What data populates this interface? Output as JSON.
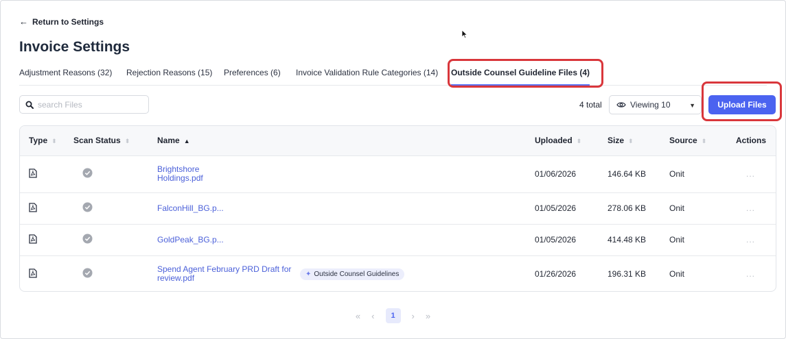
{
  "nav": {
    "back_label": "Return to Settings",
    "back_arrow": "←"
  },
  "page": {
    "title": "Invoice Settings"
  },
  "tabs": [
    {
      "label": "Adjustment Reasons (32)"
    },
    {
      "label": "Rejection Reasons (15)"
    },
    {
      "label": "Preferences (6)"
    },
    {
      "label": "Invoice Validation Rule Categories (14)"
    },
    {
      "label": "Outside Counsel Guideline Files (4)",
      "active": true
    }
  ],
  "toolbar": {
    "search_placeholder": "search Files",
    "search_value": "",
    "total_label": "4 total",
    "viewing_label": "Viewing 10",
    "viewing_caret": "▼",
    "upload_label": "Upload Files"
  },
  "table": {
    "headers": {
      "type": "Type",
      "scan": "Scan Status",
      "name": "Name",
      "uploaded": "Uploaded",
      "size": "Size",
      "source": "Source",
      "actions": "Actions"
    },
    "sort_neutral": "⬍",
    "sort_asc": "▲",
    "rows": [
      {
        "name": "Brightshore Holdings.pdf",
        "uploaded": "01/06/2026",
        "size": "146.64 KB",
        "source": "Onit",
        "actions": "...",
        "tag": ""
      },
      {
        "name": "FalconHill_BG.p...",
        "uploaded": "01/05/2026",
        "size": "278.06 KB",
        "source": "Onit",
        "actions": "...",
        "tag": ""
      },
      {
        "name": "GoldPeak_BG.p...",
        "uploaded": "01/05/2026",
        "size": "414.48 KB",
        "source": "Onit",
        "actions": "...",
        "tag": ""
      },
      {
        "name": "Spend Agent February PRD Draft for review.pdf",
        "uploaded": "01/26/2026",
        "size": "196.31 KB",
        "source": "Onit",
        "actions": "...",
        "tag": "Outside Counsel Guidelines"
      }
    ]
  },
  "pagination": {
    "first": "«",
    "prev": "‹",
    "current": "1",
    "next": "›",
    "last": "»"
  },
  "colors": {
    "accent": "#4b63f0",
    "link": "#4a5fd9",
    "highlight": "#d9363b",
    "tag_bg": "#eceefc"
  },
  "icons": {
    "file": "pdf-file-icon",
    "scan": "check-circle-icon",
    "search": "search-icon",
    "view": "eye-icon"
  }
}
